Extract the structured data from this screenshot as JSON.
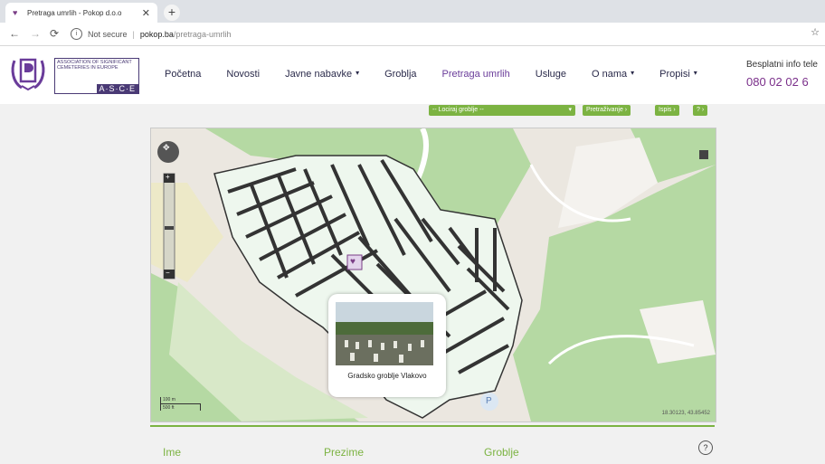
{
  "browser": {
    "tab_title": "Pretraga umrlih - Pokop d.o.o",
    "tab_close": "✕",
    "new_tab": "+",
    "back": "←",
    "forward": "→",
    "reload": "⟳",
    "security": "Not secure",
    "url_host": "pokop.ba",
    "url_path": "/pretraga-umrlih",
    "bookmark": "☆"
  },
  "logo": {
    "asce_text": "ASSOCIATION OF SIGNIFICANT CEMETERIES IN EUROPE",
    "asce_badge": "A·S·C·E"
  },
  "menu": {
    "items": [
      {
        "label": "Početna",
        "dropdown": false
      },
      {
        "label": "Novosti",
        "dropdown": false
      },
      {
        "label": "Javne nabavke",
        "dropdown": true
      },
      {
        "label": "Groblja",
        "dropdown": false
      },
      {
        "label": "Pretraga umrlih",
        "dropdown": false,
        "active": true
      },
      {
        "label": "Usluge",
        "dropdown": false
      },
      {
        "label": "O nama",
        "dropdown": true
      },
      {
        "label": "Propisi",
        "dropdown": true
      }
    ]
  },
  "info": {
    "label": "Besplatni info tele",
    "number": "080 02 02 6"
  },
  "toolbar": {
    "locate_select": "-- Lociraj groblje --",
    "search_btn": "Pretraživanje ›",
    "ispis_btn": "Ispis ›",
    "help_btn": "? ›"
  },
  "map": {
    "popup_caption": "Gradsko groblje Vlakovo",
    "coordinates": "18.30123, 43.85452",
    "scale_top": "100 m",
    "scale_bottom": "500 ft",
    "parking_label": "P"
  },
  "form": {
    "ime": "Ime",
    "prezime": "Prezime",
    "groblje": "Groblje",
    "help": "?"
  },
  "colors": {
    "accent_green": "#7cb342",
    "brand_purple": "#6a3c9a"
  }
}
